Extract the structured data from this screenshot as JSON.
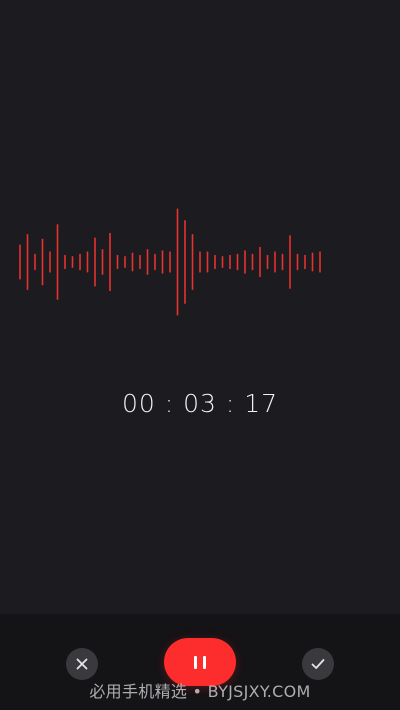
{
  "recorder": {
    "timer": "00 : 03 : 17",
    "waveform_color": "#e8322d",
    "waveform_levels": [
      0.3,
      0.48,
      0.14,
      0.4,
      0.18,
      0.65,
      0.12,
      0.1,
      0.14,
      0.18,
      0.42,
      0.22,
      0.5,
      0.12,
      0.1,
      0.16,
      0.12,
      0.22,
      0.14,
      0.2,
      0.18,
      0.92,
      0.72,
      0.48,
      0.18,
      0.18,
      0.12,
      0.1,
      0.12,
      0.14,
      0.2,
      0.14,
      0.26,
      0.12,
      0.18,
      0.14,
      0.46,
      0.14,
      0.12,
      0.16,
      0.18
    ]
  },
  "controls": {
    "cancel_icon": "close-icon",
    "pause_icon": "pause-icon",
    "confirm_icon": "check-icon",
    "pause_color": "#fe2d2d"
  },
  "watermark": {
    "text": "必用手机精选 • BYJSJXY.COM"
  }
}
